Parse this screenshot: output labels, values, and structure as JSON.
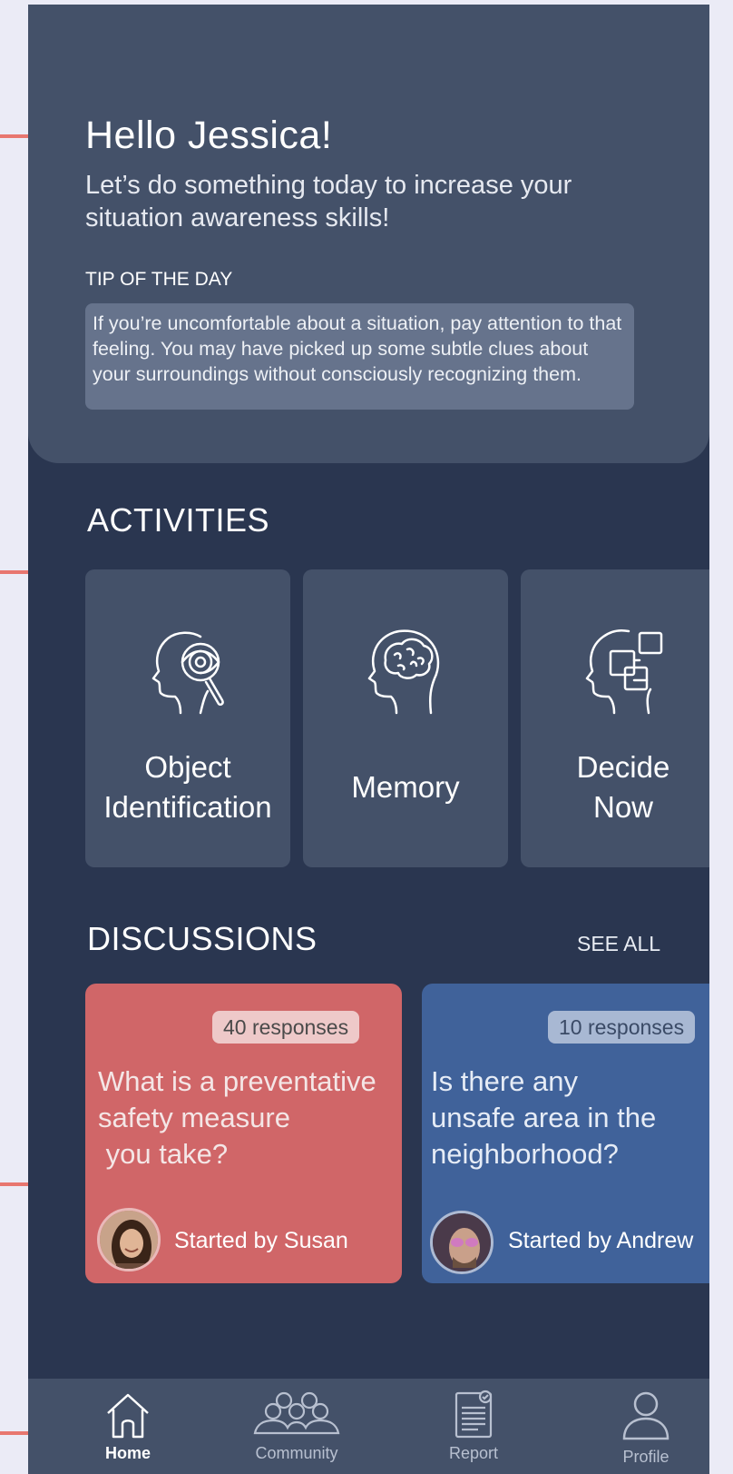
{
  "greeting": "Hello Jessica!",
  "subtitle": "Let’s do something today to increase your situation awareness skills!",
  "tip": {
    "label": "TIP OF THE DAY",
    "text": "If you’re uncomfortable about a situation, pay attention to that feeling. You may have picked up some subtle clues about your surroundings without consciously recognizing them."
  },
  "activities": {
    "title": "ACTIVITIES",
    "items": [
      {
        "label": "Object\nIdentification",
        "icon": "head-magnifier-icon"
      },
      {
        "label": "Memory",
        "icon": "head-brain-icon"
      },
      {
        "label": "Decide\nNow",
        "icon": "head-puzzle-icon"
      }
    ]
  },
  "discussions": {
    "title": "DISCUSSIONS",
    "see_all": "SEE ALL",
    "items": [
      {
        "responses": "40 responses",
        "question": "What is a preventative\nsafety measure\n you take?",
        "starter": "Started by Susan",
        "color": "#d06668"
      },
      {
        "responses": "10 responses",
        "question": "Is there any\nunsafe area in the\nneighborhood?",
        "starter": "Started by Andrew",
        "color": "#40629a"
      }
    ]
  },
  "tabs": [
    {
      "label": "Home",
      "icon": "home-icon",
      "active": true
    },
    {
      "label": "Community",
      "icon": "community-icon",
      "active": false
    },
    {
      "label": "Report",
      "icon": "report-icon",
      "active": false
    },
    {
      "label": "Profile",
      "icon": "profile-icon",
      "active": false
    }
  ],
  "colors": {
    "background": "#2a3650",
    "card": "#445169",
    "accent_pointer": "#e8766f"
  }
}
